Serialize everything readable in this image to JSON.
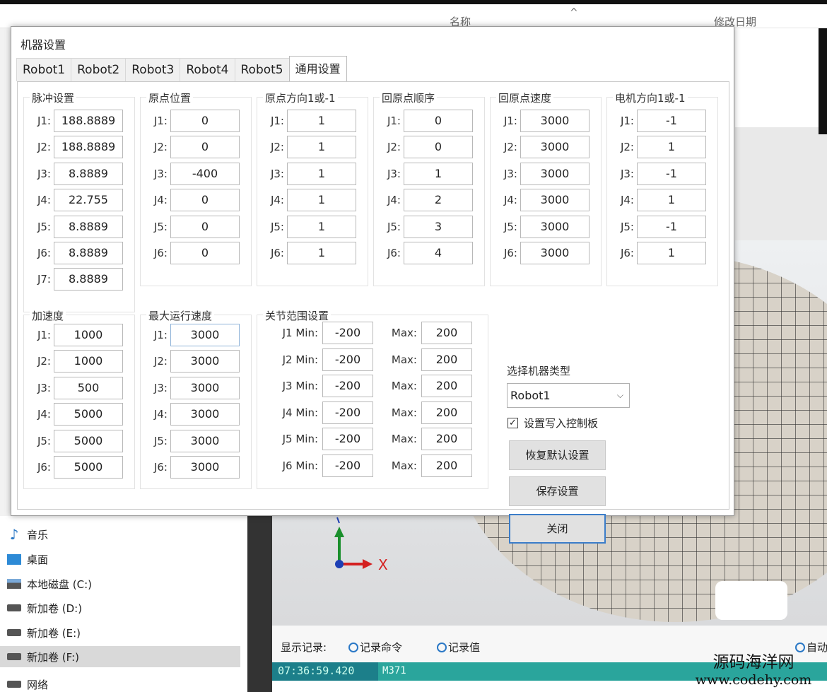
{
  "explorer": {
    "col_name": "名称",
    "col_modified": "修改日期",
    "sidebar": [
      {
        "label": "音乐",
        "icon": "music-note-icon"
      },
      {
        "label": "桌面",
        "icon": "desktop-icon"
      },
      {
        "label": "本地磁盘 (C:)",
        "icon": "local-disk-icon"
      },
      {
        "label": "新加卷 (D:)",
        "icon": "drive-icon"
      },
      {
        "label": "新加卷 (E:)",
        "icon": "drive-icon"
      },
      {
        "label": "新加卷 (F:)",
        "icon": "drive-icon"
      },
      {
        "label": "网络",
        "icon": "network-icon"
      }
    ]
  },
  "viewport": {
    "axis_x_label": "X"
  },
  "log": {
    "show_label": "显示记录:",
    "radio_cmd": "记录命令",
    "radio_val": "记录值",
    "radio_auto": "自动",
    "time": "07:36:59.420",
    "cmd": "M371"
  },
  "watermark": {
    "line1": "源码海洋网",
    "line2": "www.codehy.com"
  },
  "dialog": {
    "title": "机器设置",
    "tabs": [
      "Robot1",
      "Robot2",
      "Robot3",
      "Robot4",
      "Robot5",
      "通用设置"
    ],
    "active_tab": 5,
    "groups_top": [
      {
        "title": "脉冲设置",
        "labels": [
          "J1:",
          "J2:",
          "J3:",
          "J4:",
          "J5:",
          "J6:",
          "J7:"
        ],
        "values": [
          "188.8889",
          "188.8889",
          "8.8889",
          "22.755",
          "8.8889",
          "8.8889",
          "8.8889"
        ]
      },
      {
        "title": "原点位置",
        "labels": [
          "J1:",
          "J2:",
          "J3:",
          "J4:",
          "J5:",
          "J6:"
        ],
        "values": [
          "0",
          "0",
          "-400",
          "0",
          "0",
          "0"
        ]
      },
      {
        "title": "原点方向1或-1",
        "labels": [
          "J1:",
          "J2:",
          "J3:",
          "J4:",
          "J5:",
          "J6:"
        ],
        "values": [
          "1",
          "1",
          "1",
          "1",
          "1",
          "1"
        ]
      },
      {
        "title": "回原点顺序",
        "labels": [
          "J1:",
          "J2:",
          "J3:",
          "J4:",
          "J5:",
          "J6:"
        ],
        "values": [
          "0",
          "0",
          "1",
          "2",
          "3",
          "4"
        ]
      },
      {
        "title": "回原点速度",
        "labels": [
          "J1:",
          "J2:",
          "J3:",
          "J4:",
          "J5:",
          "J6:"
        ],
        "values": [
          "3000",
          "3000",
          "3000",
          "3000",
          "3000",
          "3000"
        ]
      },
      {
        "title": "电机方向1或-1",
        "labels": [
          "J1:",
          "J2:",
          "J3:",
          "J4:",
          "J5:",
          "J6:"
        ],
        "values": [
          "-1",
          "1",
          "-1",
          "1",
          "-1",
          "1"
        ]
      }
    ],
    "accel": {
      "title": "加速度",
      "labels": [
        "J1:",
        "J2:",
        "J3:",
        "J4:",
        "J5:",
        "J6:"
      ],
      "values": [
        "1000",
        "1000",
        "500",
        "5000",
        "5000",
        "5000"
      ]
    },
    "maxspeed": {
      "title": "最大运行速度",
      "labels": [
        "J1:",
        "J2:",
        "J3:",
        "J4:",
        "J5:",
        "J6:"
      ],
      "values": [
        "3000",
        "3000",
        "3000",
        "3000",
        "3000",
        "3000"
      ]
    },
    "range": {
      "title": "关节范围设置",
      "min_labels": [
        "J1 Min:",
        "J2 Min:",
        "J3 Min:",
        "J4 Min:",
        "J5 Min:",
        "J6 Min:"
      ],
      "max_label": "Max:",
      "min_values": [
        "-200",
        "-200",
        "-200",
        "-200",
        "-200",
        "-200"
      ],
      "max_values": [
        "200",
        "200",
        "200",
        "200",
        "200",
        "200"
      ]
    },
    "select_label": "选择机器类型",
    "select_value": "Robot1",
    "write_checkbox_label": "设置写入控制板",
    "write_checked": true,
    "btn_restore": "恢复默认设置",
    "btn_save": "保存设置",
    "btn_close": "关闭"
  }
}
